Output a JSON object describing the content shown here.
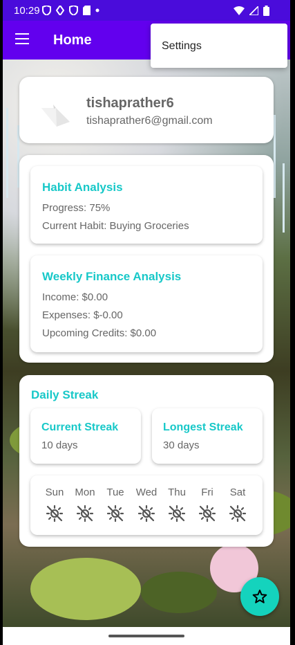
{
  "status": {
    "time": "10:29"
  },
  "appbar": {
    "title": "Home",
    "menu_icon": "hamburger-menu-icon"
  },
  "menu": {
    "settings_label": "Settings"
  },
  "profile": {
    "username": "tishaprather6",
    "email": "tishaprather6@gmail.com",
    "icon": "profile-image-icon"
  },
  "habit": {
    "title": "Habit Analysis",
    "progress": "Progress: 75%",
    "current_habit": "Current Habit: Buying Groceries"
  },
  "finance": {
    "title": "Weekly Finance Analysis",
    "income": "Income: $0.00",
    "expenses": "Expenses: $-0.00",
    "credits": "Upcoming Credits: $0.00"
  },
  "streak": {
    "title": "Daily Streak",
    "current_label": "Current Streak",
    "current_value": "10 days",
    "longest_label": "Longest Streak",
    "longest_value": "30 days",
    "days": [
      "Sun",
      "Mon",
      "Tue",
      "Wed",
      "Thu",
      "Fri",
      "Sat"
    ],
    "day_icon": "sun-off-icon"
  },
  "fab": {
    "icon": "star-icon"
  },
  "colors": {
    "status_bar": "#4a0cdb",
    "app_bar": "#6200ee",
    "accent": "#17c8c8",
    "fab": "#14d3bd"
  }
}
